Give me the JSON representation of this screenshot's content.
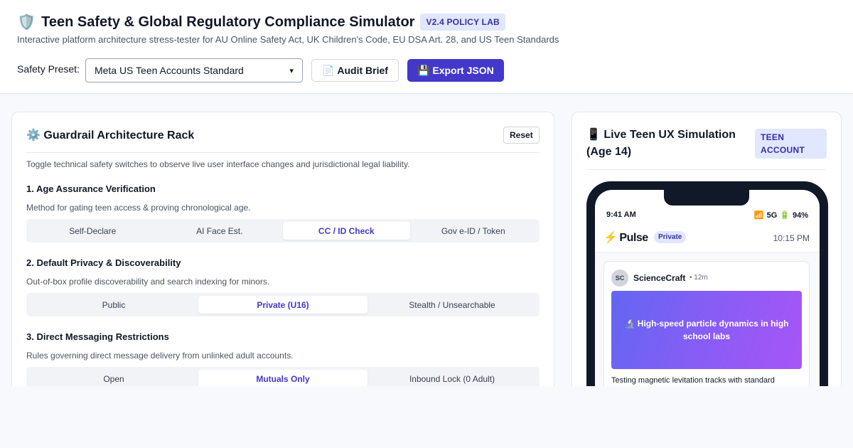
{
  "header": {
    "title_icon": "🛡️",
    "title": "Teen Safety & Global Regulatory Compliance Simulator",
    "version_badge": "V2.4 POLICY LAB",
    "subtitle": "Interactive platform architecture stress-tester for AU Online Safety Act, UK Children's Code, EU DSA Art. 28, and US Teen Standards",
    "preset_label": "Safety Preset:",
    "preset_value": "Meta US Teen Accounts Standard",
    "audit_icon": "📄",
    "audit_label": "Audit Brief",
    "export_icon": "💾",
    "export_label": "Export JSON",
    "accent_color": "#4338ca"
  },
  "rack": {
    "title": "⚙️ Guardrail Architecture Rack",
    "reset_label": "Reset",
    "description": "Toggle technical safety switches to observe live user interface changes and jurisdictional legal liability.",
    "sections": [
      {
        "title": "1. Age Assurance Verification",
        "description": "Method for gating teen access & proving chronological age.",
        "options": [
          "Self-Declare",
          "AI Face Est.",
          "CC / ID Check",
          "Gov e-ID / Token"
        ],
        "selected": "CC / ID Check"
      },
      {
        "title": "2. Default Privacy & Discoverability",
        "description": "Out-of-box profile discoverability and search indexing for minors.",
        "options": [
          "Public",
          "Private (U16)",
          "Stealth / Unsearchable"
        ],
        "selected": "Private (U16)"
      },
      {
        "title": "3. Direct Messaging Restrictions",
        "description": "Rules governing direct message delivery from unlinked adult accounts.",
        "options": [
          "Open",
          "Mutuals Only",
          "Inbound Lock (0 Adult)"
        ],
        "selected": "Mutuals Only"
      }
    ]
  },
  "simulation": {
    "title": "📱 Live Teen UX Simulation (Age 14)",
    "account_badge": "TEEN ACCOUNT",
    "phone": {
      "status_time": "9:41 AM",
      "signal_icon": "📶",
      "network": "5G",
      "battery_icon": "🔋",
      "battery": "94%",
      "app_icon": "⚡",
      "app_name": "Pulse",
      "privacy_pill": "Private",
      "clock": "10:15 PM",
      "post": {
        "avatar_initials": "SC",
        "author": "ScienceCraft",
        "age": "• 12m",
        "media_caption": "🔬 High-speed particle dynamics in high school labs",
        "text": "Testing magnetic levitation tracks with standard"
      }
    }
  }
}
